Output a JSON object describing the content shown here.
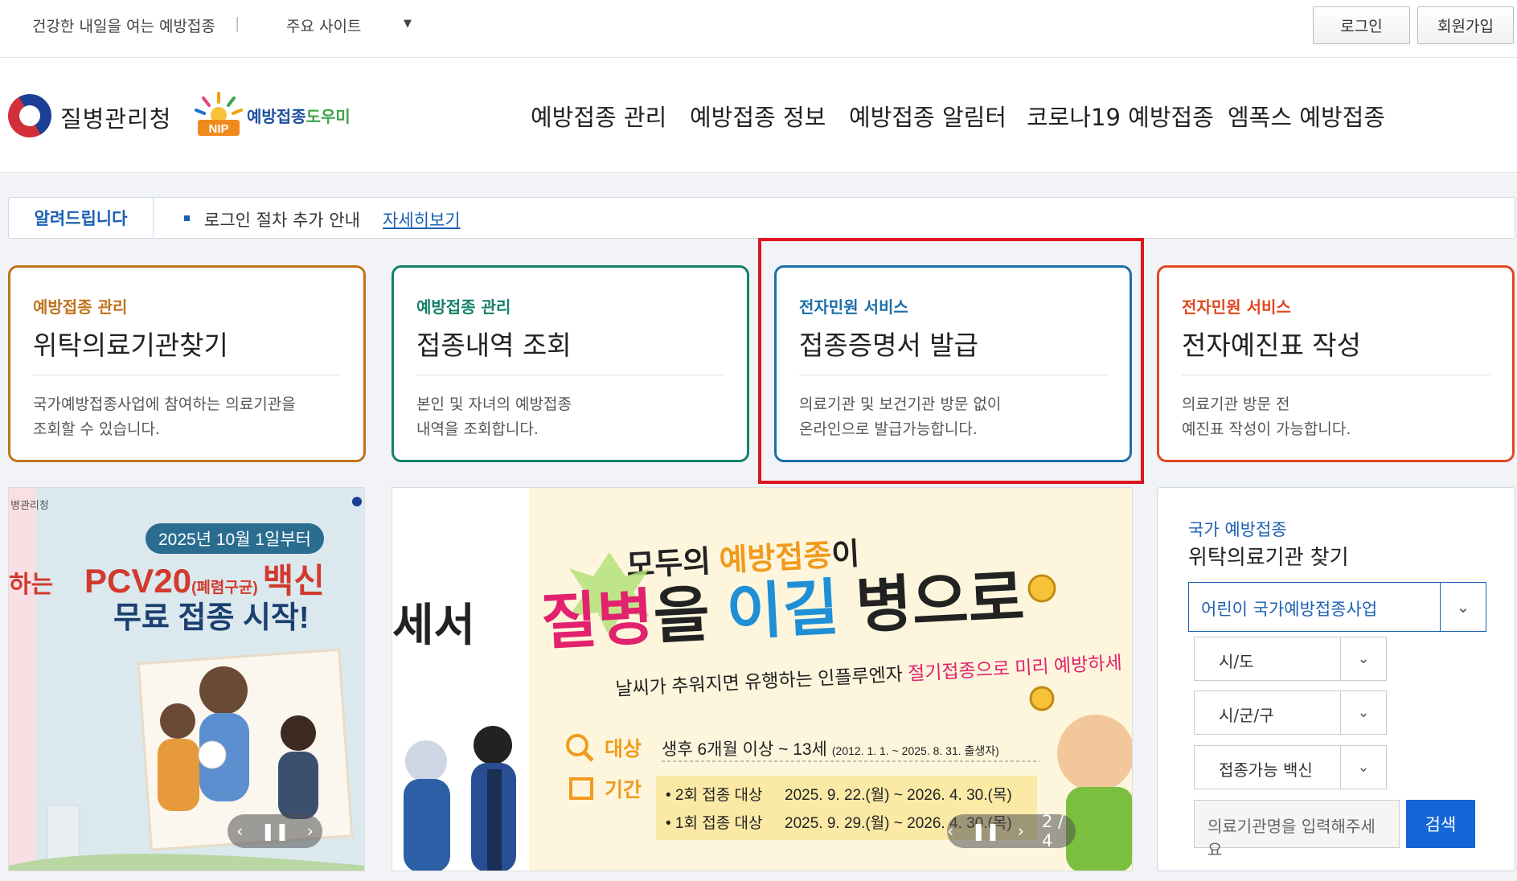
{
  "topbar": {
    "slogan": "건강한 내일을 여는 예방접종",
    "separator": "|",
    "sites_label": "주요 사이트",
    "sites_arrow": "▼",
    "login": "로그인",
    "signup": "회원가입"
  },
  "header": {
    "agency": "질병관리청",
    "nip_logo_text": "NIP",
    "nip_name_a": "예방접종",
    "nip_name_b": "도우미",
    "nav": [
      "예방접종 관리",
      "예방접종 정보",
      "예방접종 알림터",
      "코로나19 예방접종",
      "엠폭스 예방접종"
    ]
  },
  "notice": {
    "label": "알려드립니다",
    "message": "로그인 절차 추가 안내",
    "more": "자세히보기"
  },
  "cards": [
    {
      "category": "예방접종 관리",
      "title": "위탁의료기관찾기",
      "desc1": "국가예방접종사업에 참여하는 의료기관을",
      "desc2": "조회할 수 있습니다.",
      "color": "#c0731c"
    },
    {
      "category": "예방접종 관리",
      "title": "접종내역 조회",
      "desc1": "본인 및 자녀의 예방접종",
      "desc2": "내역을 조회합니다.",
      "color": "#15806a"
    },
    {
      "category": "전자민원 서비스",
      "title": "접종증명서 발급",
      "desc1": "의료기관 및 보건기관 방문 없이",
      "desc2": "온라인으로 발급가능합니다.",
      "color": "#1b6fa8"
    },
    {
      "category": "전자민원 서비스",
      "title": "전자예진표 작성",
      "desc1": "의료기관 방문 전",
      "desc2": "예진표 작성이 가능합니다.",
      "color": "#e0471f"
    }
  ],
  "banner_left": {
    "corner_text": "병관리청",
    "date_pill": "2025년 10월 1일부터",
    "headline_a": "PCV20",
    "headline_a_small": "(폐렴구균)",
    "headline_b": "백신",
    "headline_c": "무료 접종 시작!",
    "edge_text": "하는"
  },
  "banner_main": {
    "edge_text": "세서",
    "line1_a": "모두의 ",
    "line1_b": "예방접종",
    "line1_c": "이",
    "line2_a": "질병",
    "line2_b": "을 ",
    "line2_c": "이길",
    "line2_d": " 병으로",
    "line3_a": "날씨가 추워지면 유행하는 인플루엔자 ",
    "line3_b": "절기접종으로 미리 예방하세",
    "target_label": "대상",
    "target_text": "생후 6개월 이상 ~ 13세",
    "target_small": "(2012. 1. 1. ~ 2025. 8. 31. 출생자)",
    "period_label": "기간",
    "period_rows": [
      {
        "who": "• 2회 접종 대상",
        "when": "2025. 9. 22.(월) ~ 2026. 4. 30.(목)"
      },
      {
        "who": "• 1회 접종 대상",
        "when": "2025. 9. 29.(월) ~ 2026. 4. 30.(목)"
      }
    ],
    "page_indicator": "2 / 4"
  },
  "search_panel": {
    "subtitle": "국가 예방접종",
    "title": "위탁의료기관 찾기",
    "program_select": "어린이 국가예방접종사업",
    "sido": "시/도",
    "sigungu": "시/군/구",
    "vaccine": "접종가능 백신",
    "input_placeholder": "의료기관명을 입력해주세요",
    "search_button": "검색"
  }
}
